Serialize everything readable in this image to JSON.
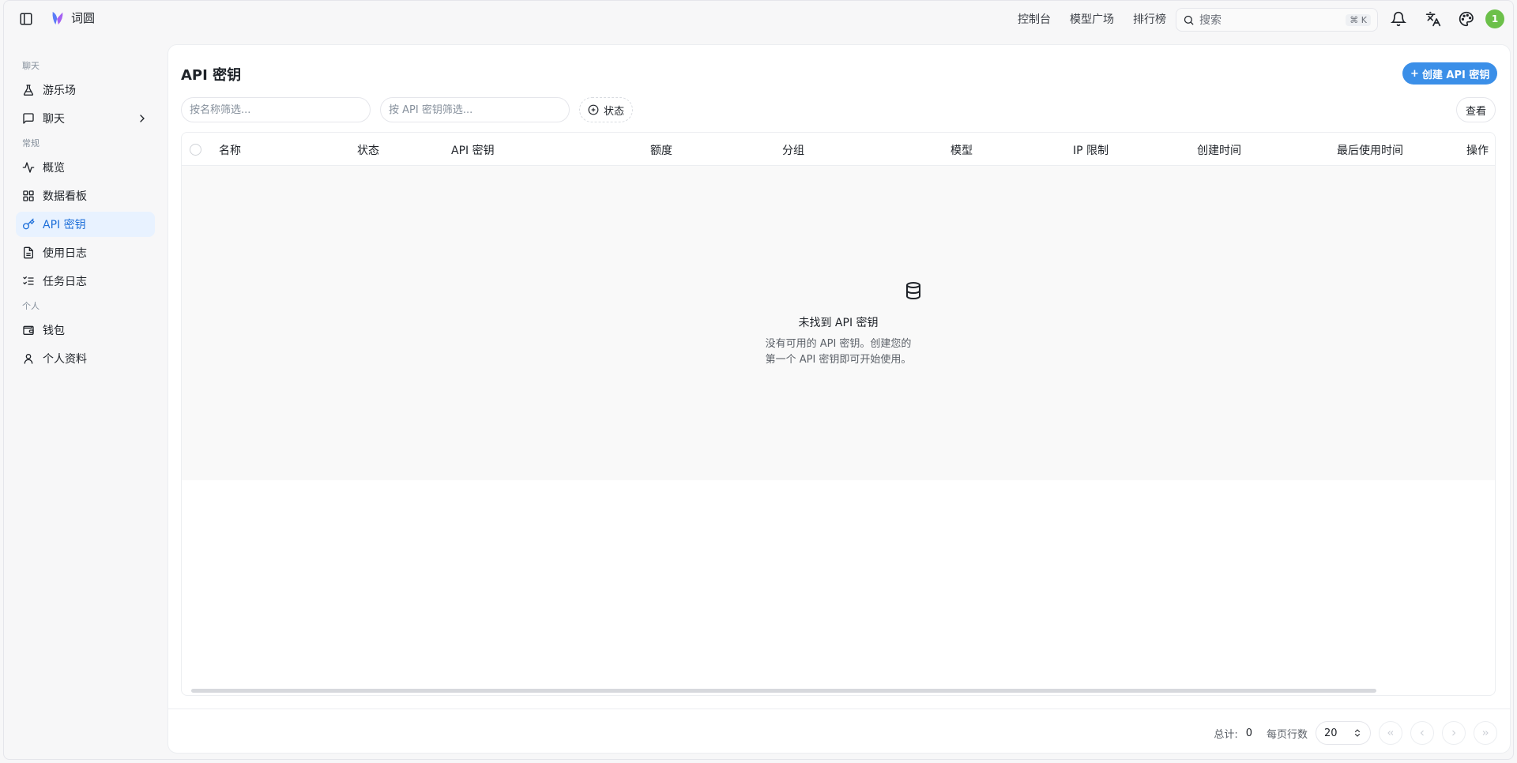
{
  "app": {
    "name": "词圆"
  },
  "topnav": {
    "items": [
      "控制台",
      "模型广场",
      "排行榜"
    ]
  },
  "search": {
    "placeholder": "搜索",
    "shortcut": "⌘ K"
  },
  "user": {
    "avatar_text": "1"
  },
  "sidebar": {
    "sections": [
      {
        "label": "聊天",
        "items": [
          {
            "label": "游乐场",
            "icon": "flask-icon"
          },
          {
            "label": "聊天",
            "icon": "message-icon",
            "expandable": true
          }
        ]
      },
      {
        "label": "常规",
        "items": [
          {
            "label": "概览",
            "icon": "activity-icon"
          },
          {
            "label": "数据看板",
            "icon": "dashboard-icon"
          },
          {
            "label": "API 密钥",
            "icon": "key-icon",
            "active": true
          },
          {
            "label": "使用日志",
            "icon": "file-text-icon"
          },
          {
            "label": "任务日志",
            "icon": "list-checks-icon"
          }
        ]
      },
      {
        "label": "个人",
        "items": [
          {
            "label": "钱包",
            "icon": "wallet-icon"
          },
          {
            "label": "个人资料",
            "icon": "user-icon"
          }
        ]
      }
    ]
  },
  "main": {
    "title": "API 密钥",
    "create_button": "创建 API 密钥",
    "filters": {
      "name_placeholder": "按名称筛选...",
      "key_placeholder": "按 API 密钥筛选...",
      "status_label": "状态"
    },
    "view_button": "查看",
    "table": {
      "columns": [
        "名称",
        "状态",
        "API 密钥",
        "额度",
        "分组",
        "模型",
        "IP 限制",
        "创建时间",
        "最后使用时间",
        "操作"
      ],
      "rows": []
    },
    "empty": {
      "title": "未找到 API 密钥",
      "desc_line1": "没有可用的 API 密钥。创建您的",
      "desc_line2": "第一个 API 密钥即可开始使用。"
    },
    "pagination": {
      "total_label": "总计:",
      "total": "0",
      "rows_per_page_label": "每页行数",
      "rows_per_page": "20"
    }
  }
}
